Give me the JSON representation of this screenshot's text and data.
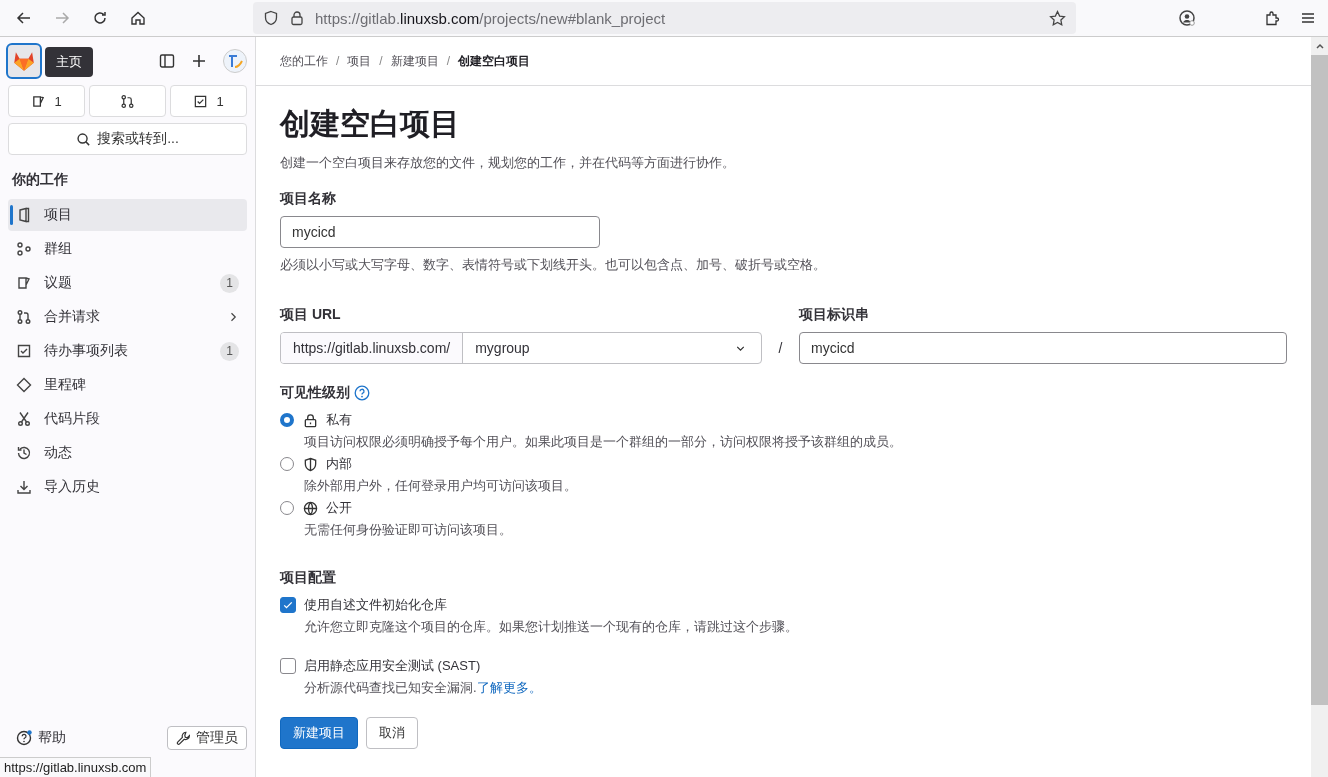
{
  "browser": {
    "url_parts": [
      {
        "text": "https://gitlab.",
        "kind": "dim"
      },
      {
        "text": "linuxsb.com",
        "kind": "host"
      },
      {
        "text": "/projects/new#blank_project",
        "kind": "dim"
      }
    ]
  },
  "sidebar": {
    "tooltip": "主页",
    "counters": [
      {
        "kind": "issues",
        "count": "1"
      },
      {
        "kind": "merge"
      },
      {
        "kind": "todo",
        "count": "1"
      }
    ],
    "search": "搜索或转到...",
    "section": "你的工作",
    "items": [
      {
        "label": "项目",
        "selected": true,
        "has_submenu": false
      },
      {
        "label": "群组",
        "selected": false,
        "has_submenu": false
      },
      {
        "label": "议题",
        "selected": false,
        "badge": "1",
        "has_submenu": false
      },
      {
        "label": "合并请求",
        "selected": false,
        "has_submenu": true
      },
      {
        "label": "待办事项列表",
        "selected": false,
        "badge": "1",
        "has_submenu": false
      },
      {
        "label": "里程碑",
        "selected": false,
        "has_submenu": false
      },
      {
        "label": "代码片段",
        "selected": false,
        "has_submenu": false
      },
      {
        "label": "动态",
        "selected": false,
        "has_submenu": false
      },
      {
        "label": "导入历史",
        "selected": false,
        "has_submenu": false
      }
    ],
    "help": "帮助",
    "admin": "管理员"
  },
  "status_url": "https://gitlab.linuxsb.com",
  "breadcrumbs": [
    "您的工作",
    "项目",
    "新建项目",
    "创建空白项目"
  ],
  "breadcrumb_separator": "/",
  "title": "创建空白项目",
  "description": "创建一个空白项目来存放您的文件，规划您的工作，并在代码等方面进行协作。",
  "name_field": {
    "label": "项目名称",
    "value": "mycicd",
    "hint": "必须以小写或大写字母、数字、表情符号或下划线开头。也可以包含点、加号、破折号或空格。"
  },
  "url_field": {
    "label": "项目 URL",
    "prefix": "https://gitlab.linuxsb.com/",
    "group": "mygroup",
    "separator": "/"
  },
  "slug_field": {
    "label": "项目标识串",
    "value": "mycicd"
  },
  "visibility": {
    "label": "可见性级别",
    "options": [
      {
        "label": "私有",
        "description": "项目访问权限必须明确授予每个用户。如果此项目是一个群组的一部分，访问权限将授予该群组的成员。",
        "selected": true
      },
      {
        "label": "内部",
        "description": "除外部用户外，任何登录用户均可访问该项目。",
        "selected": false
      },
      {
        "label": "公开",
        "description": "无需任何身份验证即可访问该项目。",
        "selected": false
      }
    ]
  },
  "config": {
    "label": "项目配置",
    "options": [
      {
        "label": "使用自述文件初始化仓库",
        "description": "允许您立即克隆这个项目的仓库。如果您计划推送一个现有的仓库，请跳过这个步骤。",
        "checked": true
      },
      {
        "label": "启用静态应用安全测试 (SAST)",
        "description": "分析源代码查找已知安全漏洞.",
        "link": "了解更多。",
        "checked": false
      }
    ]
  },
  "buttons": {
    "primary": "新建项目",
    "cancel": "取消"
  }
}
